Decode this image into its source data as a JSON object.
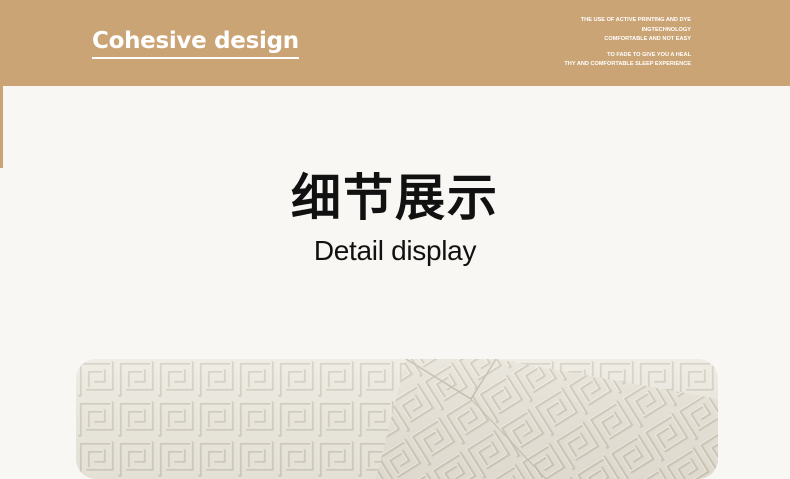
{
  "banner": {
    "title": "Cohesive design",
    "text_lines": [
      "THE USE OF ACTIVE PRINTING AND DYE",
      "INGTECHNOLOGY",
      "COMFORTABLE AND NOT EASY",
      "TO FADE TO GIVE YOU A HEAL",
      "THY AND COMFORTABLE SLEEP EXPERIENCE"
    ],
    "color": "#cba475"
  },
  "section": {
    "title_cn": "细节展示",
    "title_en": "Detail display"
  },
  "image": {
    "subject": "quilted fabric close-up with geometric fret pattern",
    "fabric_color": "#ece9df"
  }
}
